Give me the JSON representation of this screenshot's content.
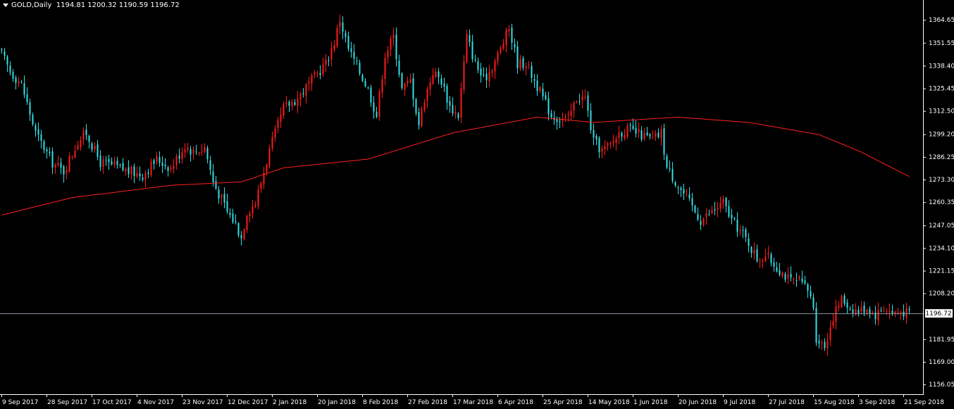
{
  "header": {
    "symbol": "GOLD,Daily",
    "ohlc": "1194.81 1200.32 1190.59 1196.72"
  },
  "colors": {
    "background": "#000000",
    "up_candle": "#ff1a1a",
    "down_candle": "#33e0e6",
    "moving_average": "#ff2020",
    "axis": "#ffffff",
    "price_line": "#8c96a0"
  },
  "chart_data": {
    "type": "candlestick",
    "y_ticks": [
      "1364.65",
      "1351.55",
      "1338.40",
      "1325.45",
      "1312.50",
      "1299.20",
      "1286.25",
      "1273.30",
      "1260.35",
      "1247.05",
      "1234.10",
      "1221.15",
      "1208.20",
      "1181.95",
      "1169.00",
      "1156.05"
    ],
    "current_price": "1196.72",
    "ylim": [
      1154.5,
      1372
    ],
    "x_ticks": [
      "9 Sep 2017",
      "28 Sep 2017",
      "17 Oct 2017",
      "4 Nov 2017",
      "23 Nov 2017",
      "12 Dec 2017",
      "2 Jan 2018",
      "20 Jan 2018",
      "8 Feb 2018",
      "27 Feb 2018",
      "17 Mar 2018",
      "6 Apr 2018",
      "25 Apr 2018",
      "14 May 2018",
      "1 Jun 2018",
      "20 Jun 2018",
      "9 Jul 2018",
      "27 Jul 2018",
      "15 Aug 2018",
      "3 Sep 2018",
      "21 Sep 2018"
    ],
    "close_anchors": [
      [
        0,
        1345
      ],
      [
        3,
        1335
      ],
      [
        7,
        1328
      ],
      [
        12,
        1300
      ],
      [
        18,
        1283
      ],
      [
        22,
        1278
      ],
      [
        27,
        1295
      ],
      [
        30,
        1300
      ],
      [
        35,
        1283
      ],
      [
        40,
        1281
      ],
      [
        45,
        1278
      ],
      [
        50,
        1276
      ],
      [
        55,
        1285
      ],
      [
        60,
        1280
      ],
      [
        65,
        1293
      ],
      [
        68,
        1289
      ],
      [
        72,
        1292
      ],
      [
        75,
        1272
      ],
      [
        80,
        1255
      ],
      [
        83,
        1248
      ],
      [
        85,
        1240
      ],
      [
        87,
        1255
      ],
      [
        90,
        1260
      ],
      [
        95,
        1290
      ],
      [
        100,
        1314
      ],
      [
        105,
        1320
      ],
      [
        110,
        1330
      ],
      [
        115,
        1340
      ],
      [
        118,
        1352
      ],
      [
        120,
        1365
      ],
      [
        123,
        1348
      ],
      [
        127,
        1335
      ],
      [
        130,
        1325
      ],
      [
        133,
        1310
      ],
      [
        136,
        1345
      ],
      [
        139,
        1355
      ],
      [
        142,
        1325
      ],
      [
        145,
        1330
      ],
      [
        148,
        1305
      ],
      [
        150,
        1320
      ],
      [
        153,
        1335
      ],
      [
        156,
        1330
      ],
      [
        159,
        1315
      ],
      [
        162,
        1310
      ],
      [
        165,
        1355
      ],
      [
        168,
        1340
      ],
      [
        171,
        1330
      ],
      [
        174,
        1338
      ],
      [
        177,
        1348
      ],
      [
        180,
        1360
      ],
      [
        183,
        1340
      ],
      [
        186,
        1340
      ],
      [
        189,
        1330
      ],
      [
        192,
        1320
      ],
      [
        195,
        1310
      ],
      [
        198,
        1308
      ],
      [
        201,
        1308
      ],
      [
        204,
        1320
      ],
      [
        207,
        1320
      ],
      [
        210,
        1295
      ],
      [
        213,
        1290
      ],
      [
        216,
        1293
      ],
      [
        219,
        1300
      ],
      [
        222,
        1302
      ],
      [
        225,
        1300
      ],
      [
        228,
        1298
      ],
      [
        231,
        1296
      ],
      [
        234,
        1300
      ],
      [
        236,
        1280
      ],
      [
        240,
        1270
      ],
      [
        244,
        1260
      ],
      [
        248,
        1250
      ],
      [
        252,
        1255
      ],
      [
        256,
        1260
      ],
      [
        259,
        1250
      ],
      [
        262,
        1244
      ],
      [
        265,
        1237
      ],
      [
        268,
        1228
      ],
      [
        271,
        1230
      ],
      [
        274,
        1225
      ],
      [
        277,
        1220
      ],
      [
        280,
        1215
      ],
      [
        283,
        1215
      ],
      [
        286,
        1210
      ],
      [
        288,
        1201
      ],
      [
        289,
        1183
      ],
      [
        292,
        1178
      ],
      [
        295,
        1195
      ],
      [
        298,
        1205
      ],
      [
        301,
        1200
      ],
      [
        304,
        1198
      ],
      [
        307,
        1200
      ],
      [
        310,
        1196
      ],
      [
        313,
        1200
      ],
      [
        316,
        1197
      ],
      [
        319,
        1198
      ],
      [
        322,
        1196.7
      ]
    ],
    "ma_anchors": [
      [
        0,
        1253
      ],
      [
        25,
        1263
      ],
      [
        60,
        1270
      ],
      [
        85,
        1272
      ],
      [
        100,
        1280
      ],
      [
        130,
        1285
      ],
      [
        160,
        1300
      ],
      [
        190,
        1309
      ],
      [
        210,
        1306
      ],
      [
        240,
        1309
      ],
      [
        265,
        1306
      ],
      [
        290,
        1299
      ],
      [
        305,
        1289
      ],
      [
        322,
        1275
      ]
    ]
  }
}
